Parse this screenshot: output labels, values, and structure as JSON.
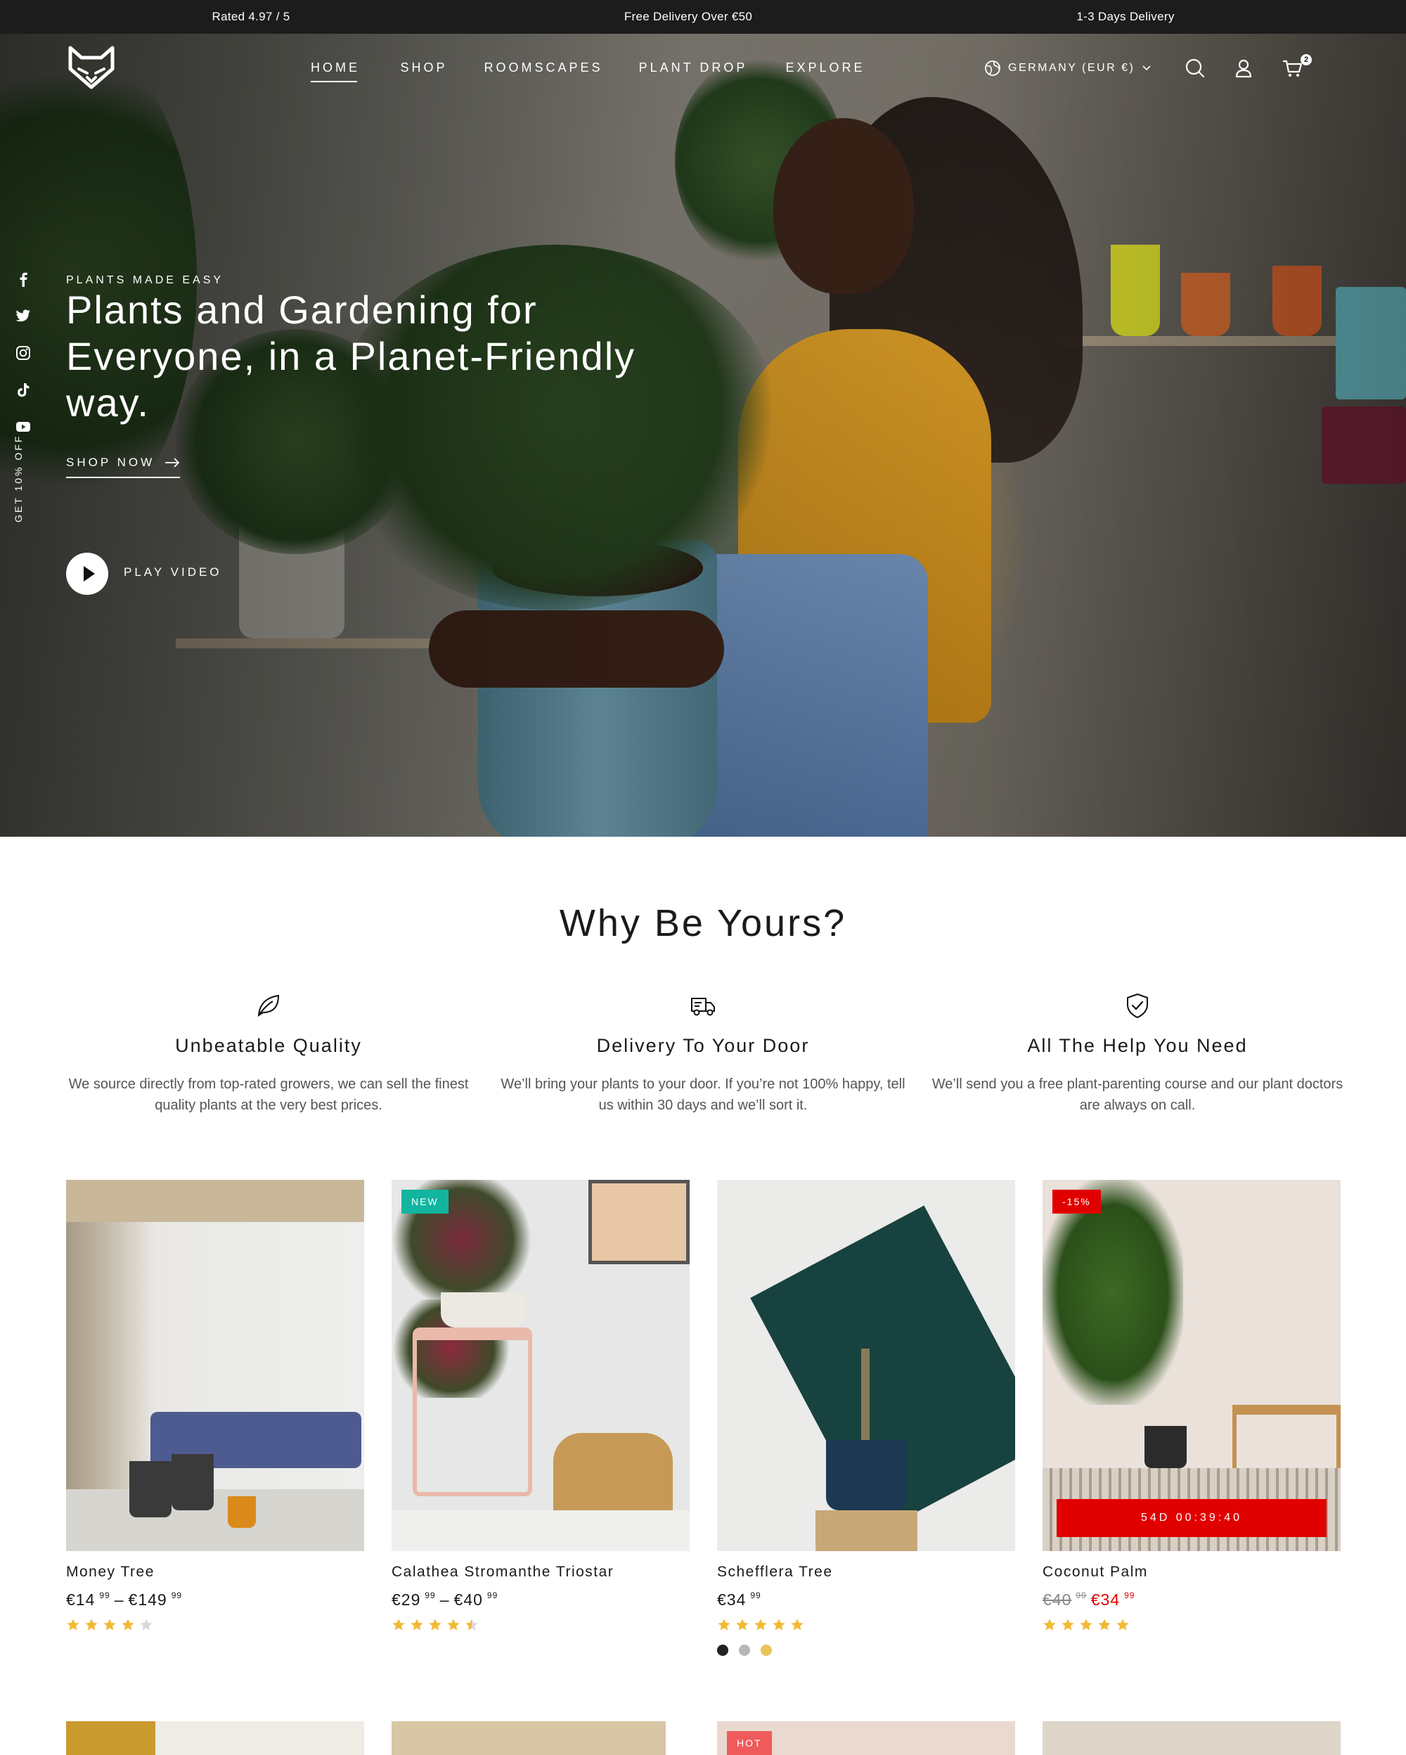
{
  "announcement": {
    "rating": "Rated 4.97 / 5",
    "delivery_threshold": "Free Delivery Over €50",
    "delivery_time": "1-3 Days Delivery"
  },
  "header": {
    "nav": [
      "HOME",
      "SHOP",
      "ROOMSCAPES",
      "PLANT DROP",
      "EXPLORE"
    ],
    "locale": "GERMANY (EUR €)",
    "cart_count": "2",
    "icons": [
      "globe-icon",
      "search-icon",
      "account-icon",
      "cart-icon"
    ]
  },
  "social": [
    "facebook-icon",
    "twitter-icon",
    "instagram-icon",
    "tiktok-icon",
    "youtube-icon"
  ],
  "side_promo": "GET 10% OFF",
  "hero": {
    "eyebrow": "PLANTS MADE EASY",
    "title": "Plants and Gardening for Everyone, in a Planet-Friendly way.",
    "cta": "SHOP NOW",
    "video_label": "PLAY VIDEO"
  },
  "why": {
    "title": "Why Be Yours?",
    "features": [
      {
        "icon": "leaf-icon",
        "title": "Unbeatable Quality",
        "text": "We source directly from top-rated growers, we can sell the finest quality plants at the very best prices."
      },
      {
        "icon": "delivery-truck-icon",
        "title": "Delivery To Your Door",
        "text": "We’ll bring your plants to your door. If you’re not 100% happy, tell us within 30 days and we’ll sort it."
      },
      {
        "icon": "shield-check-icon",
        "title": "All The Help You Need",
        "text": "We’ll send you a free plant-parenting course and our plant doctors are always on call."
      }
    ]
  },
  "products": [
    {
      "name": "Money Tree",
      "price_from": "€14",
      "price_from_cents": "99",
      "price_to": "€149",
      "price_to_cents": "99",
      "rating": 4,
      "badge": ""
    },
    {
      "name": "Calathea Stromanthe Triostar",
      "price_from": "€29",
      "price_from_cents": "99",
      "price_to": "€40",
      "price_to_cents": "99",
      "rating": 4.5,
      "badge": "NEW",
      "badge_color": "#12b5a0"
    },
    {
      "name": "Schefflera Tree",
      "price": "€34",
      "price_cents": "99",
      "rating": 5,
      "badge": "",
      "swatches": [
        "#222222",
        "#b7b7b7",
        "#e9c45a"
      ]
    },
    {
      "name": "Coconut Palm",
      "old_price": "€40",
      "old_price_cents": "99",
      "price": "€34",
      "price_cents": "99",
      "rating": 5,
      "badge": "-15%",
      "badge_color": "#e10000",
      "countdown": "54D 00:39:40"
    }
  ],
  "next_row_badge": "HOT",
  "colors": {
    "star": "#f2b933",
    "star_empty": "#d9d9d9",
    "sale": "#e10000",
    "announce_bg": "#1c1c1c"
  }
}
